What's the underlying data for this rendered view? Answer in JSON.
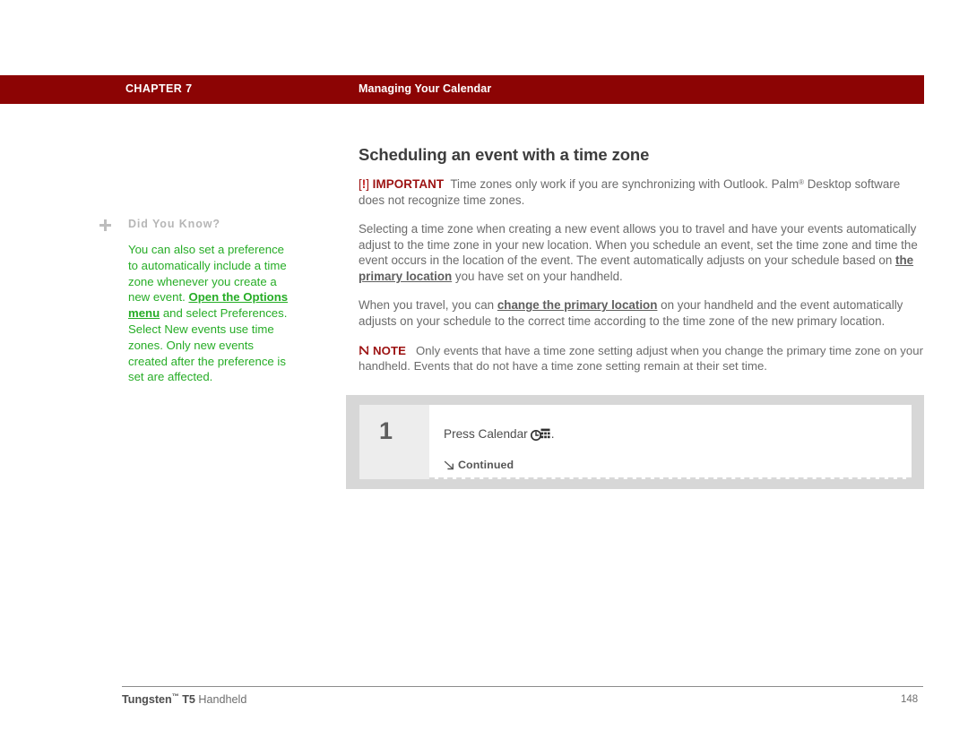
{
  "header": {
    "chapter": "CHAPTER 7",
    "section": "Managing Your Calendar",
    "bar_color": "#8c0404"
  },
  "sidebar": {
    "icon": "plus-icon",
    "title": "Did You Know?",
    "text_before_link": "You can also set a preference to automatically include a time zone whenever you create a new event. ",
    "link_text": "Open the Options menu",
    "text_after_link": " and select Preferences. Select New events use time zones. Only new events created after the preference is set are affected.",
    "text_color": "#27ad27"
  },
  "main": {
    "title": "Scheduling an event with a time zone",
    "important": {
      "bracket_open": "[",
      "bang": "!",
      "bracket_close": "]",
      "label": "IMPORTANT",
      "text_part1": "Time zones only work if you are synchronizing with Outlook. Palm",
      "registered": "®",
      "text_part2": " Desktop software does not recognize time zones.",
      "label_color": "#9c1212"
    },
    "paragraph1": {
      "before_link": "Selecting a time zone when creating a new event allows you to travel and have your events automatically adjust to the time zone in your new location. When you schedule an event, set the time zone and time the event occurs in the location of the event. The event automatically adjusts on your schedule based on ",
      "link_text": "the primary location",
      "after_link": " you have set on your handheld."
    },
    "paragraph2": {
      "before_link": "When you travel, you can ",
      "link_text": "change the primary location",
      "after_link": " on your handheld and the event automatically adjusts on your schedule to the correct time according to the time zone of the new primary location."
    },
    "note": {
      "icon": "note-arrow-icon",
      "label": "NOTE",
      "text": "Only events that have a time zone setting adjust when you change the primary time zone on your handheld. Events that do not have a time zone setting remain at their set time.",
      "label_color": "#9c1212"
    }
  },
  "step_box": {
    "number": "1",
    "instruction_prefix": "Press Calendar",
    "instruction_icon": "calendar-button-icon",
    "instruction_suffix": ".",
    "continued_icon": "arrow-down-right-icon",
    "continued_label": "Continued"
  },
  "footer": {
    "brand": "Tungsten",
    "trademark": "™",
    "model": " T5",
    "product": " Handheld",
    "page_number": "148"
  }
}
